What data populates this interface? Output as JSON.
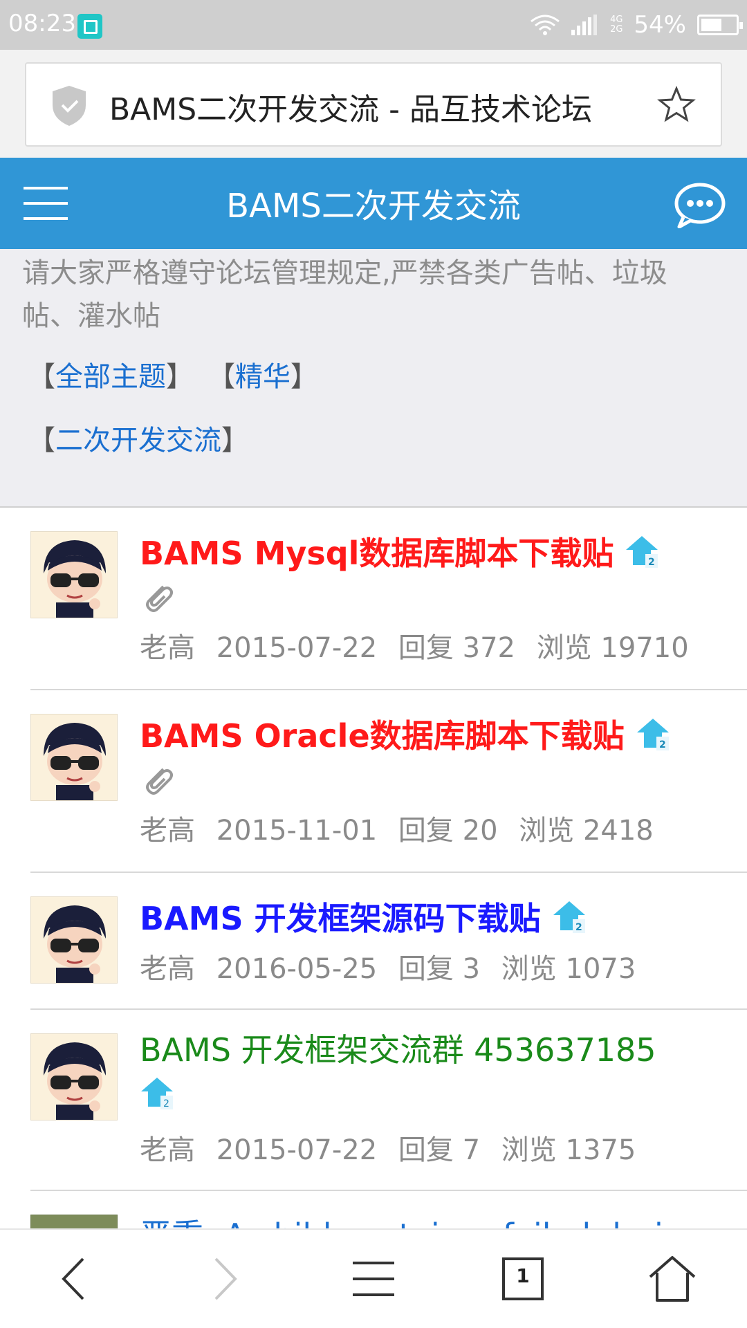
{
  "status_bar": {
    "time": "08:23",
    "network_type_top": "4G",
    "network_type_bottom": "2G",
    "battery": "54%",
    "battery_level": 0.54
  },
  "address_bar": {
    "page_title": "BAMS二次开发交流 - 品互技术论坛"
  },
  "header": {
    "title": "BAMS二次开发交流"
  },
  "notice": {
    "text": "请大家严格遵守论坛管理规定,严禁各类广告帖、垃圾帖、灌水帖",
    "tabs": [
      {
        "label": "全部主题"
      },
      {
        "label": "精华"
      },
      {
        "label": "二次开发交流"
      }
    ]
  },
  "threads": [
    {
      "title": "BAMS Mysql数据库脚本下载贴",
      "color": "#ff1a1a",
      "author": "老高",
      "date": "2015-07-22",
      "replies": "回复 372",
      "views": "浏览 19710",
      "attachment": true
    },
    {
      "title": "BAMS Oracle数据库脚本下载贴",
      "color": "#ff1a1a",
      "author": "老高",
      "date": "2015-11-01",
      "replies": "回复 20",
      "views": "浏览 2418",
      "attachment": true
    },
    {
      "title": "BAMS 开发框架源码下载贴",
      "color": "#1a1aff",
      "author": "老高",
      "date": "2016-05-25",
      "replies": "回复 3",
      "views": "浏览 1073",
      "attachment": false
    },
    {
      "title": "BAMS 开发框架交流群 453637185",
      "color": "#1a8a1a",
      "author": "老高",
      "date": "2015-07-22",
      "replies": "回复 7",
      "views": "浏览 1375",
      "attachment": false
    },
    {
      "title": "严重: A child container failed during",
      "color": "#1a6fd0"
    }
  ],
  "bottom_nav": {
    "tab_count": "1"
  }
}
